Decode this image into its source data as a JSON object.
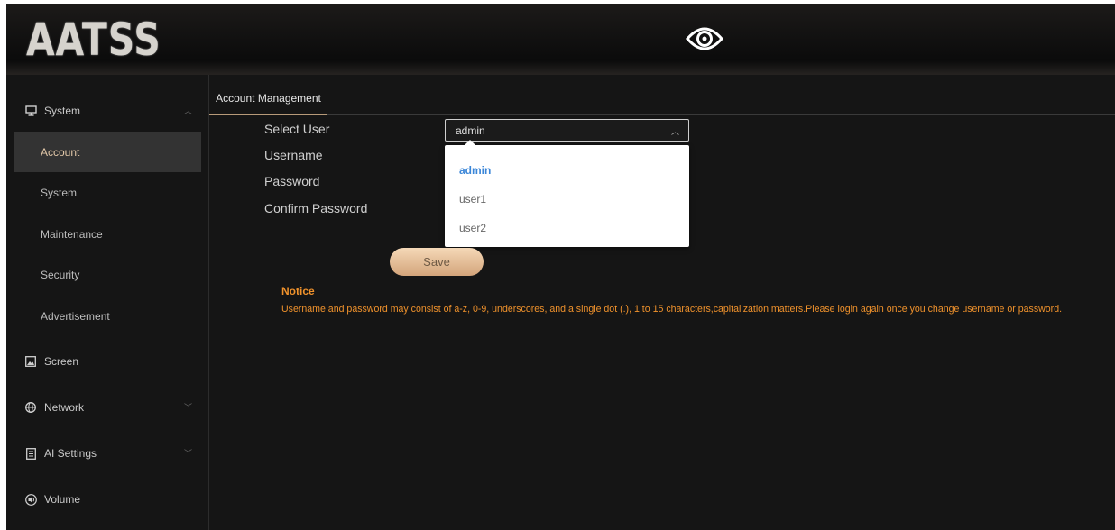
{
  "header": {
    "logo_text": "AATSS",
    "eye_icon": "eye-icon"
  },
  "sidebar": {
    "system": {
      "label": "System",
      "icon": "monitor-icon",
      "submenu": [
        "Account",
        "System",
        "Maintenance",
        "Security",
        "Advertisement"
      ],
      "active": "Account"
    },
    "screen": {
      "label": "Screen",
      "icon": "image-icon"
    },
    "network": {
      "label": "Network",
      "icon": "globe-icon"
    },
    "ai_settings": {
      "label": "AI Settings",
      "icon": "document-icon"
    },
    "volume": {
      "label": "Volume",
      "icon": "speaker-icon"
    }
  },
  "main": {
    "tab": "Account Management",
    "form": {
      "select_user_label": "Select User",
      "username_label": "Username",
      "password_label": "Password",
      "confirm_password_label": "Confirm Password",
      "selected_user": "admin",
      "options": [
        "admin",
        "user1",
        "user2"
      ],
      "save_label": "Save"
    },
    "notice": {
      "title": "Notice",
      "text": "Username and password may consist of a-z, 0-9, underscores, and a single dot (.), 1 to 15 characters,capitalization matters.Please login again once you change username or password."
    }
  },
  "colors": {
    "accent": "#e4c9a9",
    "notice": "#f0922c",
    "selected_option": "#3b86d8",
    "background": "#151515"
  }
}
